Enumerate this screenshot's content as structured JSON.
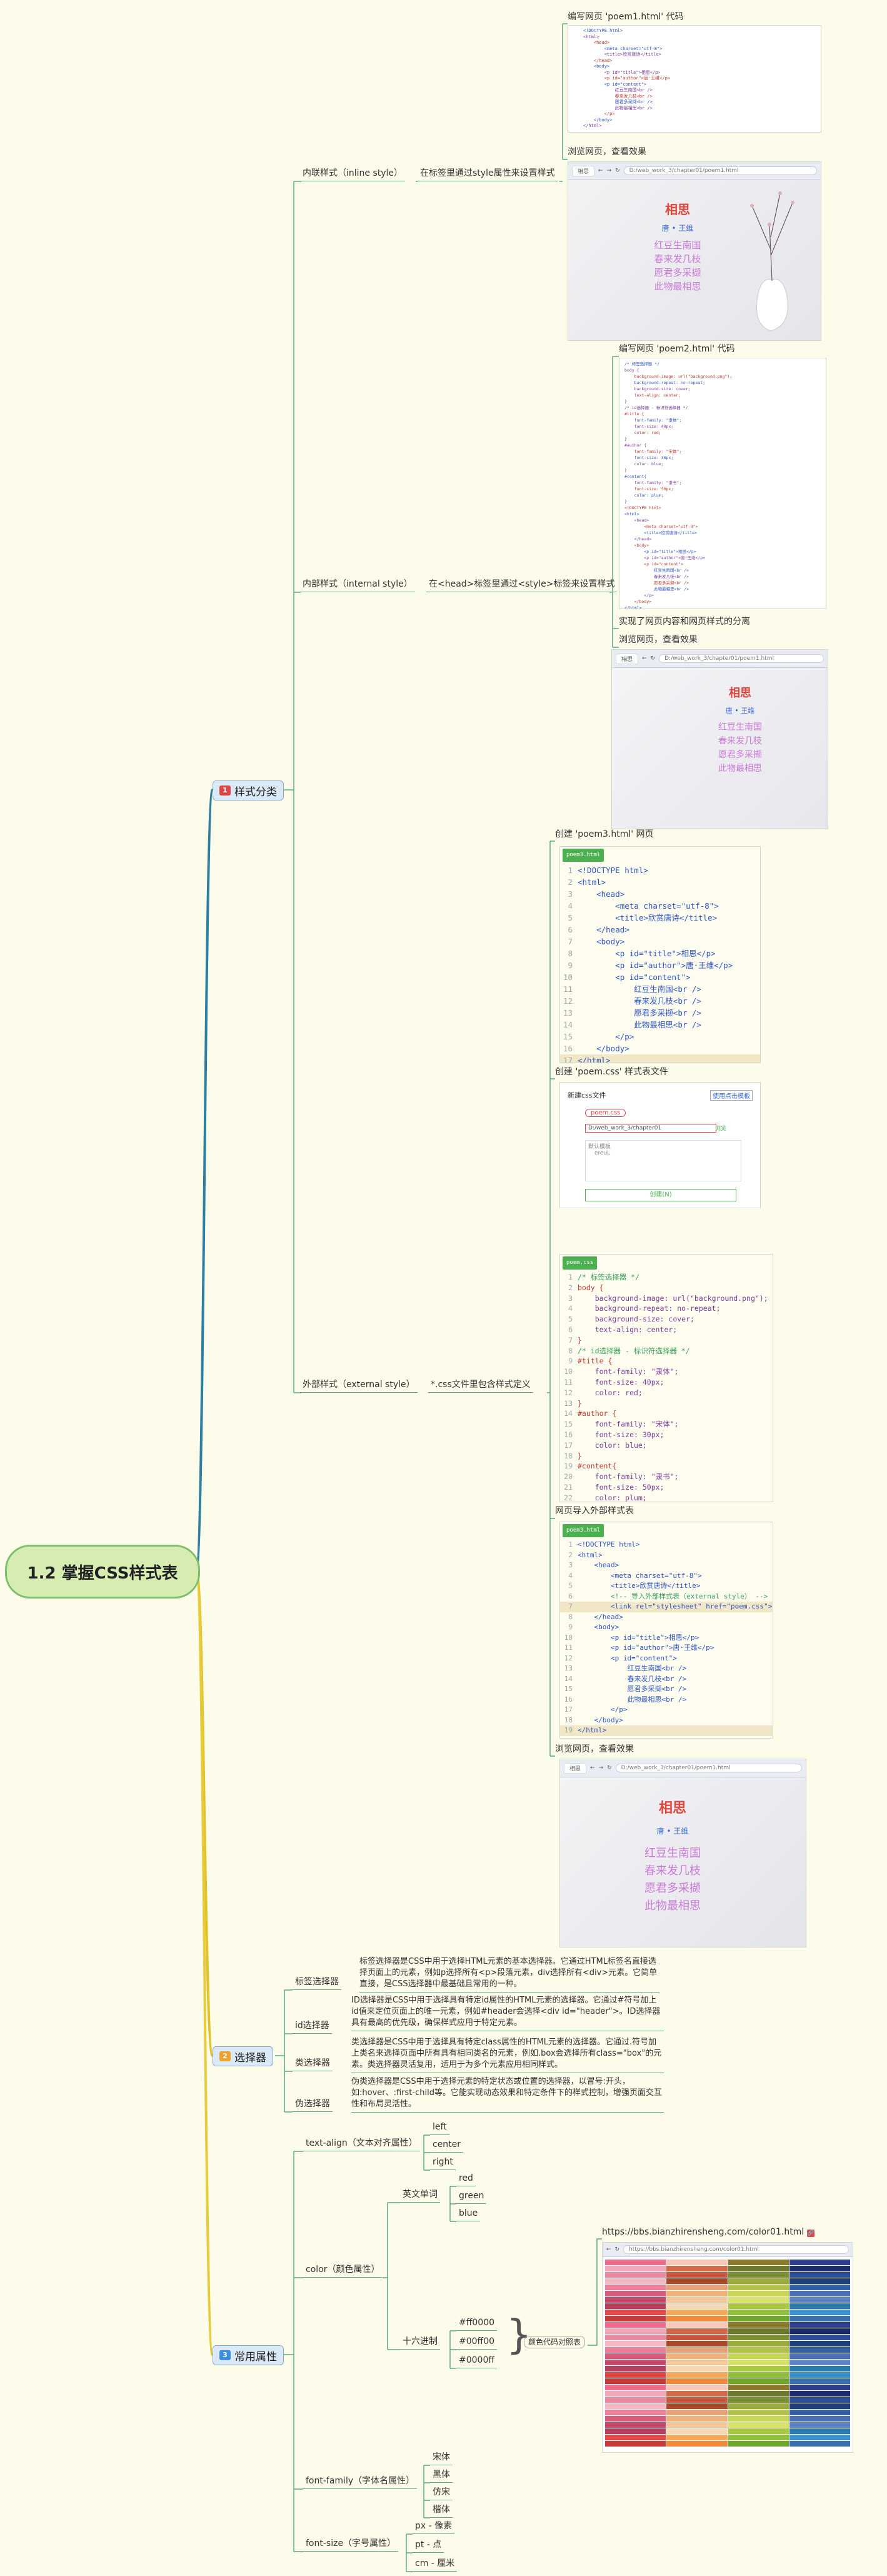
{
  "root": {
    "title": "1.2 掌握CSS样式表"
  },
  "categories": [
    {
      "num": "1",
      "label": "样式分类"
    },
    {
      "num": "2",
      "label": "选择器"
    },
    {
      "num": "3",
      "label": "常用属性"
    }
  ],
  "style_types": {
    "inline": {
      "label": "内联样式（inline style）",
      "desc": "在标签里通过style属性来设置样式",
      "s1": "编写网页 'poem1.html' 代码",
      "s2": "浏览网页，查看效果"
    },
    "internal": {
      "label": "内部样式（internal style）",
      "desc": "在<head>标签里通过<style>标签来设置样式",
      "s1": "编写网页 'poem2.html' 代码",
      "s2": "实现了网页内容和网页样式的分离",
      "s3": "浏览网页，查看效果"
    },
    "external": {
      "label": "外部样式（external style）",
      "desc": "*.css文件里包含样式定义",
      "s1": "创建 'poem3.html' 网页",
      "s2": "创建 'poem.css' 样式表文件",
      "s3": "网页导入外部样式表",
      "s4": "浏览网页，查看效果"
    }
  },
  "poem": {
    "title": "相思",
    "author": "唐 • 王维",
    "lines": [
      "红豆生南国",
      "春来发几枝",
      "愿君多采撷",
      "此物最相思"
    ],
    "tab": "相思",
    "url": "D:/web_work_3/chapter01/poem1.html"
  },
  "code_poem3": [
    "<!DOCTYPE html>",
    "<html>",
    "    <head>",
    "        <meta charset=\"utf-8\">",
    "        <title>欣赏唐诗</title>",
    "    </head>",
    "    <body>",
    "        <p id=\"title\">相思</p>",
    "        <p id=\"author\">唐·王维</p>",
    "        <p id=\"content\">",
    "            红豆生南国<br />",
    "            春来发几枝<br />",
    "            愿君多采撷<br />",
    "            此物最相思<br />",
    "        </p>",
    "    </body>",
    "</html>"
  ],
  "code_css": [
    "/* 标签选择器 */",
    "body {",
    "    background-image: url(\"background.png\");",
    "    background-repeat: no-repeat;",
    "    background-size: cover;",
    "    text-align: center;",
    "}",
    "/* id选择器 - 标识符选择器 */",
    "#title {",
    "    font-family: \"隶体\";",
    "    font-size: 40px;",
    "    color: red;",
    "}",
    "#author {",
    "    font-family: \"宋体\";",
    "    font-size: 30px;",
    "    color: blue;",
    "}",
    "#content{",
    "    font-family: \"隶书\";",
    "    font-size: 50px;",
    "    color: plum;",
    "}"
  ],
  "code_link": [
    "<!DOCTYPE html>",
    "<html>",
    "    <head>",
    "        <meta charset=\"utf-8\">",
    "        <title>欣赏唐诗</title>",
    "        <!-- 导入外部样式表（external style） -->",
    "        <link rel=\"stylesheet\" href=\"poem.css\">",
    "    </head>",
    "    <body>",
    "        <p id=\"title\">相思</p>",
    "        <p id=\"author\">唐·王维</p>",
    "        <p id=\"content\">",
    "            红豆生南国<br />",
    "            春来发几枝<br />",
    "            愿君多采撷<br />",
    "            此物最相思<br />",
    "        </p>",
    "    </body>",
    "</html>"
  ],
  "new_css_dialog": {
    "title": "新建css文件",
    "action": "使用点击模板",
    "file": "poem.css",
    "path": "D:/web_work_3/chapter01",
    "browse": "浏览",
    "template_label": "默认模板",
    "template_code": "ereuL",
    "create": "创建(N)"
  },
  "selectors": [
    {
      "label": "标签选择器",
      "desc": "标签选择器是CSS中用于选择HTML元素的基本选择器。它通过HTML标签名直接选择页面上的元素，例如p选择所有<p>段落元素，div选择所有<div>元素。它简单直接，是CSS选择器中最基础且常用的一种。"
    },
    {
      "label": "id选择器",
      "desc": "ID选择器是CSS中用于选择具有特定id属性的HTML元素的选择器。它通过#符号加上id值来定位页面上的唯一元素，例如#header会选择<div id=\"header\">。ID选择器具有最高的优先级，确保样式应用于特定元素。"
    },
    {
      "label": "类选择器",
      "desc": "类选择器是CSS中用于选择具有特定class属性的HTML元素的选择器。它通过.符号加上类名来选择页面中所有具有相同类名的元素，例如.box会选择所有class=\"box\"的元素。类选择器灵活复用，适用于为多个元素应用相同样式。"
    },
    {
      "label": "伪选择器",
      "desc": "伪类选择器是CSS中用于选择元素的特定状态或位置的选择器，以冒号:开头，如:hover、:first-child等。它能实现动态效果和特定条件下的样式控制，增强页面交互性和布局灵活性。"
    }
  ],
  "props": {
    "text_align": {
      "label": "text-align（文本对齐属性）",
      "values": [
        "left",
        "center",
        "right"
      ]
    },
    "color": {
      "label": "color（颜色属性）",
      "english": {
        "label": "英文单词",
        "values": [
          "red",
          "green",
          "blue"
        ]
      },
      "hex": {
        "label": "十六进制",
        "values": [
          "#ff0000",
          "#00ff00",
          "#0000ff"
        ],
        "note": "颜色代码对照表"
      },
      "url": "https://bbs.bianzhirensheng.com/color01.html"
    },
    "font_family": {
      "label": "font-family（字体名属性）",
      "values": [
        "宋体",
        "黑体",
        "仿宋",
        "楷体"
      ]
    },
    "font_size": {
      "label": "font-size（字号属性）",
      "values": [
        "px - 像素",
        "pt - 点",
        "cm - 厘米"
      ]
    }
  },
  "colors": {
    "line_main": "#5aa982",
    "line_style": "#2c7fa1",
    "line_selector": "#e3c12a",
    "line_props": "#e6cc3a",
    "poem_title": "#e0463b",
    "poem_author": "#3a67d6",
    "poem_body": "#c97ad6"
  }
}
